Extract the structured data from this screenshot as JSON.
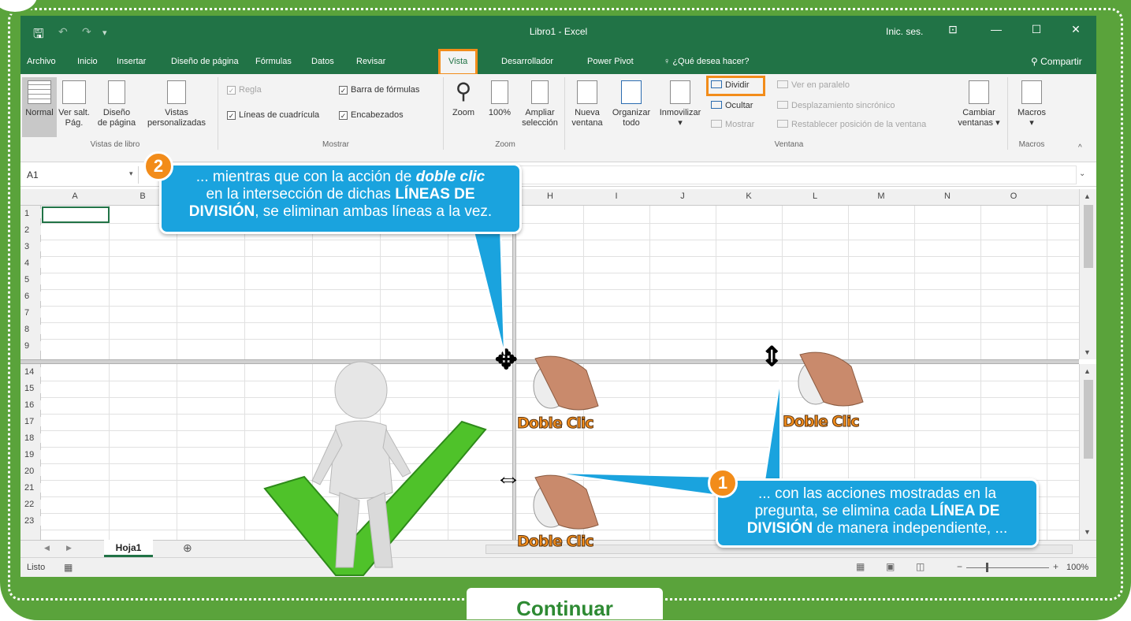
{
  "window": {
    "title": "Libro1 - Excel",
    "signin": "Inic. ses.",
    "share": "Compartir",
    "tell_me": "¿Qué desea hacer?"
  },
  "tabs": [
    "Archivo",
    "Inicio",
    "Insertar",
    "Diseño de página",
    "Fórmulas",
    "Datos",
    "Revisar",
    "Vista",
    "Desarrollador",
    "Power Pivot"
  ],
  "ribbon": {
    "vistas_libro": {
      "label": "Vistas de libro",
      "normal": "Normal",
      "ver_salt_1": "Ver salt.",
      "ver_salt_2": "Pág.",
      "diseno_1": "Diseño",
      "diseno_2": "de página",
      "vistas_1": "Vistas",
      "vistas_2": "personalizadas"
    },
    "mostrar": {
      "label": "Mostrar",
      "regla": "Regla",
      "barra": "Barra de fórmulas",
      "lineas": "Líneas de cuadrícula",
      "encabezados": "Encabezados"
    },
    "zoom": {
      "label": "Zoom",
      "zoom": "Zoom",
      "cien": "100%",
      "ampliar_1": "Ampliar",
      "ampliar_2": "selección"
    },
    "ventana": {
      "label": "Ventana",
      "nueva_1": "Nueva",
      "nueva_2": "ventana",
      "organizar_1": "Organizar",
      "organizar_2": "todo",
      "inmovilizar": "Inmovilizar",
      "dividir": "Dividir",
      "ocultar": "Ocultar",
      "mostrar": "Mostrar",
      "paralelo": "Ver en paralelo",
      "sincronico": "Desplazamiento sincrónico",
      "restablecer": "Restablecer posición de la ventana",
      "cambiar_1": "Cambiar",
      "cambiar_2": "ventanas"
    },
    "macros": {
      "label": "Macros",
      "macros": "Macros"
    }
  },
  "formula_bar": {
    "name_box": "A1"
  },
  "columns": [
    "A",
    "B",
    "H",
    "I",
    "J",
    "K",
    "L",
    "M",
    "N",
    "O"
  ],
  "rows_top": [
    "1",
    "2",
    "3",
    "4",
    "5",
    "6",
    "7",
    "8",
    "9"
  ],
  "rows_bottom": [
    "14",
    "15",
    "16",
    "17",
    "18",
    "19",
    "20",
    "21",
    "22",
    "23"
  ],
  "sheet": {
    "tab": "Hoja1",
    "add": "⊕"
  },
  "status": {
    "text": "Listo",
    "zoom": "100%"
  },
  "callout_2": {
    "badge": "2",
    "l1a": "... mientras que con la acción de ",
    "l1b": "doble clic",
    "l2a": "en la intersección de dichas ",
    "l2b": "LÍNEAS DE",
    "l3a": "DIVISIÓN",
    "l3b": ", se eliminan ambas líneas a la vez."
  },
  "callout_1": {
    "badge": "1",
    "l1": "... con las acciones mostradas en la",
    "l2a": "pregunta, se elimina cada ",
    "l2b": "LÍNEA DE",
    "l3a": "DIVISIÓN",
    "l3b": " de manera independiente, ..."
  },
  "doble_clic": "Doble Clic",
  "continuar": "Continuar",
  "colors": {
    "excel_green": "#217346",
    "frame_green": "#5aa33b",
    "highlight": "#f28c1a",
    "callout": "#1aa3de"
  }
}
